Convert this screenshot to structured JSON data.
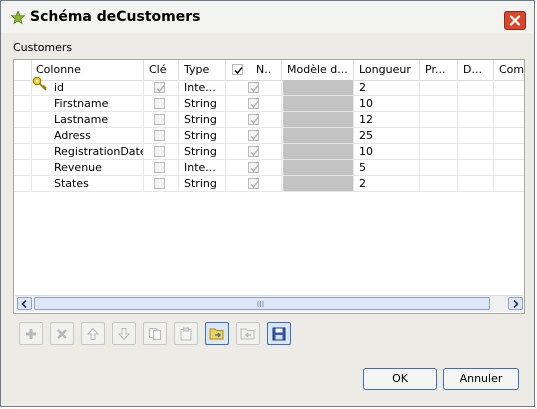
{
  "window": {
    "title": "Schéma deCustomers"
  },
  "section_label": "Customers",
  "table": {
    "columns": [
      "Colonne",
      "Clé",
      "Type",
      "N..",
      "Modèle d...",
      "Longueur",
      "Pr...",
      "D...",
      "Com..."
    ],
    "rows": [
      {
        "colonne": "id",
        "cle": true,
        "type": "Inte...",
        "nullable": true,
        "longueur": "2",
        "is_key": true
      },
      {
        "colonne": "Firstname",
        "cle": false,
        "type": "String",
        "nullable": true,
        "longueur": "10",
        "is_key": false
      },
      {
        "colonne": "Lastname",
        "cle": false,
        "type": "String",
        "nullable": true,
        "longueur": "12",
        "is_key": false
      },
      {
        "colonne": "Adress",
        "cle": false,
        "type": "String",
        "nullable": true,
        "longueur": "25",
        "is_key": false
      },
      {
        "colonne": "RegistrationDate",
        "cle": false,
        "type": "String",
        "nullable": true,
        "longueur": "10",
        "is_key": false
      },
      {
        "colonne": "Revenue",
        "cle": false,
        "type": "Inte...",
        "nullable": true,
        "longueur": "5",
        "is_key": false
      },
      {
        "colonne": "States",
        "cle": false,
        "type": "String",
        "nullable": true,
        "longueur": "2",
        "is_key": false
      }
    ]
  },
  "toolbar": {
    "buttons": [
      "add-icon",
      "remove-icon",
      "move-up-icon",
      "move-down-icon",
      "copy-icon",
      "paste-icon",
      "import-icon",
      "export-icon",
      "save-icon"
    ]
  },
  "buttons": {
    "ok": "OK",
    "cancel": "Annuler"
  },
  "colors": {
    "accent": "#3c6fb0",
    "close": "#d9462b",
    "key": "#d8a800"
  }
}
